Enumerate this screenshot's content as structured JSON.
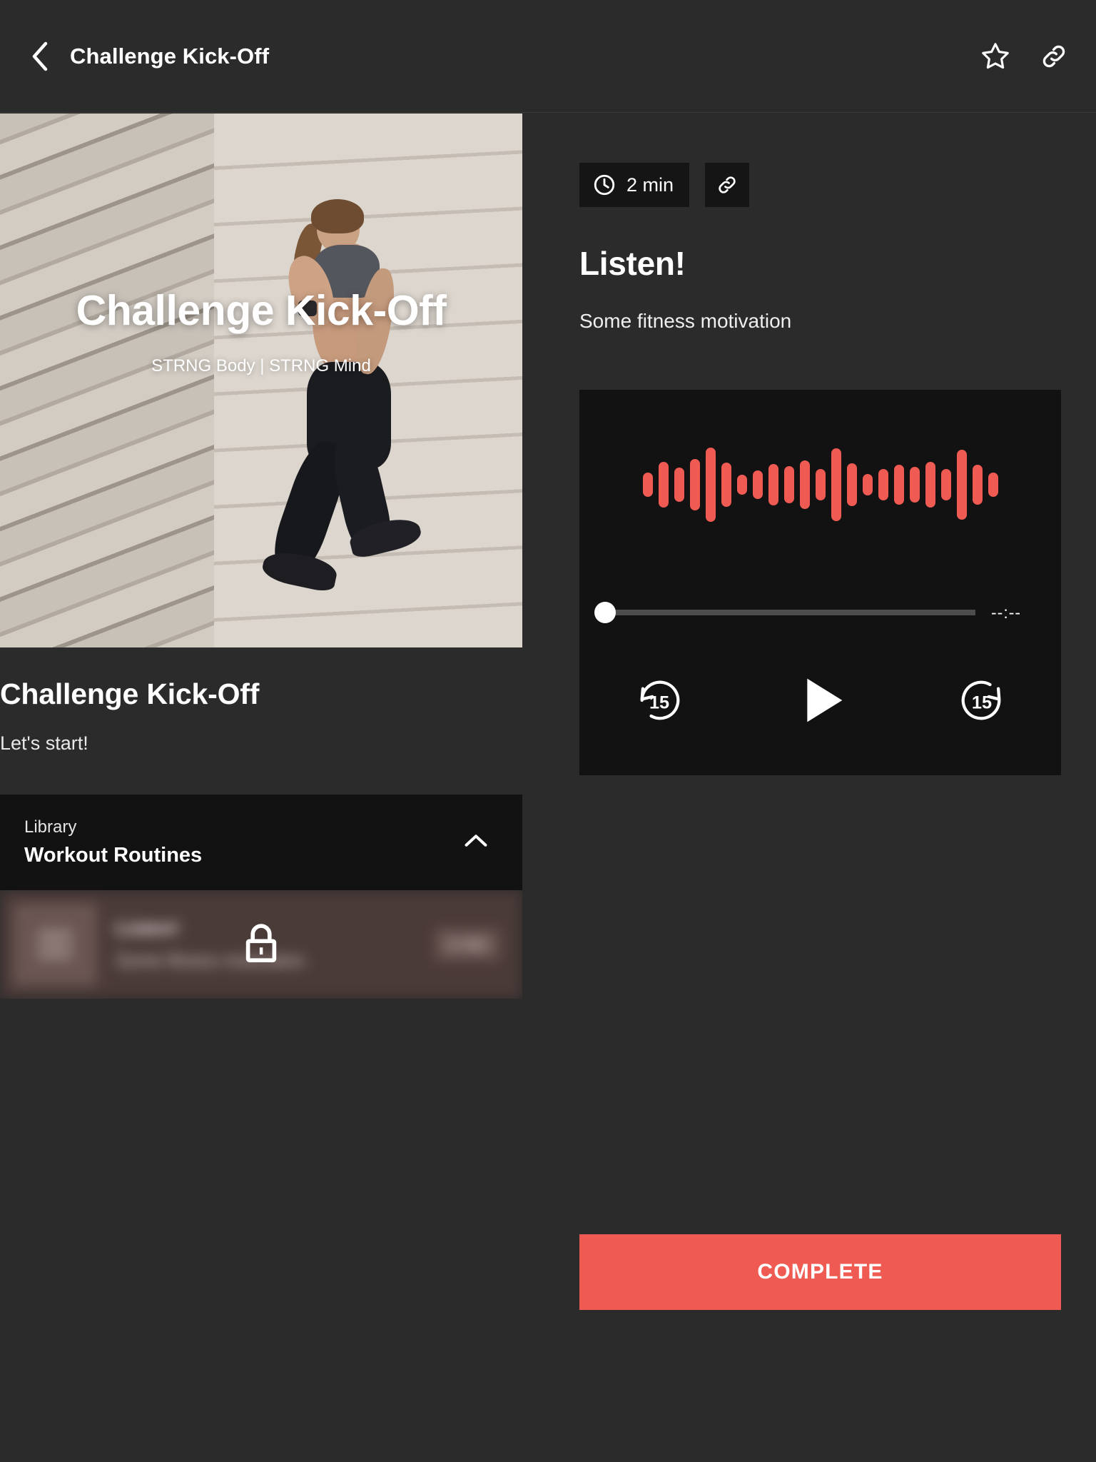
{
  "appbar": {
    "title": "Challenge Kick-Off",
    "back_icon": "chevron-left-icon",
    "favorite_icon": "star-outline-icon",
    "link_icon": "link-icon"
  },
  "hero": {
    "title": "Challenge Kick-Off",
    "subtitle": "STRNG Body | STRNG Mind"
  },
  "lesson": {
    "title": "Challenge Kick-Off",
    "description": "Let's start!"
  },
  "library": {
    "kicker": "Library",
    "name": "Workout Routines",
    "collapse_icon": "chevron-up-icon"
  },
  "locked_item": {
    "title": "Listen!",
    "subtitle": "Some fitness motivation",
    "duration": "2 min",
    "lock_icon": "lock-icon",
    "thumb_icon": "book-icon"
  },
  "detail": {
    "duration": "2 min",
    "clock_icon": "clock-icon",
    "link_icon": "link-icon",
    "title": "Listen!",
    "subtitle": "Some fitness motivation"
  },
  "player": {
    "elapsed_time": "--:--",
    "progress_percent": 0,
    "rewind_label": "15",
    "forward_label": "15",
    "rewind_icon": "replay-15-icon",
    "play_icon": "play-icon",
    "forward_icon": "forward-15-icon",
    "waveform": [
      34,
      64,
      48,
      72,
      104,
      62,
      28,
      40,
      58,
      52,
      68,
      44,
      102,
      60,
      30,
      44,
      56,
      50,
      64,
      44,
      98,
      56,
      34
    ]
  },
  "footer": {
    "complete_label": "COMPLETE"
  },
  "colors": {
    "background": "#2b2b2b",
    "surface": "#121212",
    "accent": "#ef5b52",
    "text": "#ffffff"
  }
}
